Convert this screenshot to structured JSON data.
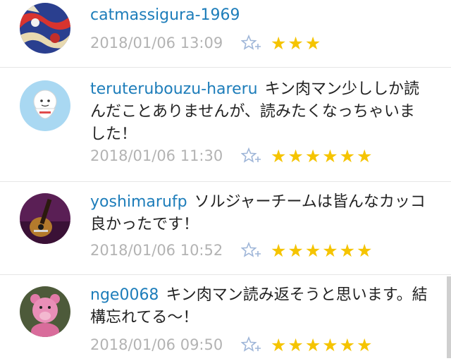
{
  "comments": [
    {
      "user": "catmassigura-1969",
      "body": "",
      "time": "2018/01/06 13:09",
      "stars_display": "★★★",
      "stars": 3,
      "avatar": "pattern-avatar"
    },
    {
      "user": "teruterubouzu-hareru",
      "body": "キン肉マン少ししか読んだことありませんが、読みたくなっちゃいました！",
      "time": "2018/01/06 11:30",
      "stars_display": "★★★★★★",
      "stars": 6,
      "avatar": "teru-teru-bozu-avatar"
    },
    {
      "user": "yoshimarufp",
      "body": "ソルジャーチームは皆んなカッコ良かったです！",
      "time": "2018/01/06 10:52",
      "stars_display": "★★★★★★",
      "stars": 6,
      "avatar": "guitar-avatar"
    },
    {
      "user": "nge0068",
      "body": "キン肉マン読み返そうと思います。結構忘れてる〜！",
      "time": "2018/01/06 09:50",
      "stars_display": "★★★★★★",
      "stars": 6,
      "avatar": "pink-bear-avatar"
    }
  ],
  "colors": {
    "username": "#1d7dba",
    "timestamp": "#b3b3b3",
    "star": "#f5c400",
    "add_star_icon": "#9fb6d8"
  }
}
